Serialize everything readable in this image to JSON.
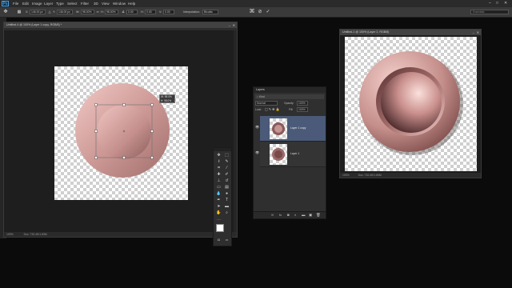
{
  "app": {
    "logo": "Ps"
  },
  "menubar": {
    "items": [
      "File",
      "Edit",
      "Image",
      "Layer",
      "Type",
      "Select",
      "Filter",
      "3D",
      "View",
      "Window",
      "Help"
    ],
    "window_controls": [
      "–",
      "□",
      "✕"
    ]
  },
  "options": {
    "x_value": "146.00 px",
    "y_value": "146.00 px",
    "w_value": "98.00%",
    "h_value": "98.00%",
    "angle_value": "0.00",
    "hskew_value": "0.00",
    "vskew_value": "0.00",
    "interpolation_label": "Interpolation:",
    "interpolation_value": "Bicubic",
    "workspace_placeholder": "Essentials"
  },
  "doc1": {
    "tab_title": "Untitled-4 @ 100% (Layer 1 copy, RGB/8) *",
    "zoom": "100%",
    "doc_size": "Doc: 732.4K/1.83M",
    "transform_readout": {
      "w": "W: 98.0%",
      "h": "H: 98.0%"
    }
  },
  "layers_panel": {
    "title": "Layers",
    "kind_label": "Kind",
    "blend_mode": "Normal",
    "opacity_label": "Opacity:",
    "opacity_value": "100%",
    "lock_label": "Lock:",
    "fill_label": "Fill:",
    "fill_value": "100%",
    "layers": [
      {
        "name": "Layer 1 copy",
        "selected": true
      },
      {
        "name": "Layer 1",
        "selected": false
      }
    ],
    "footer_icons": [
      "link-icon",
      "fx-icon",
      "mask-icon",
      "adjustment-icon",
      "group-icon",
      "new-layer-icon",
      "trash-icon"
    ]
  },
  "tools": {
    "icons": [
      "move-icon",
      "marquee-icon",
      "lasso-icon",
      "quick-select-icon",
      "crop-icon",
      "eyedropper-icon",
      "healing-icon",
      "brush-icon",
      "stamp-icon",
      "history-brush-icon",
      "eraser-icon",
      "gradient-icon",
      "blur-icon",
      "dodge-icon",
      "pen-icon",
      "type-icon",
      "path-select-icon",
      "shape-icon",
      "hand-icon",
      "zoom-icon"
    ]
  },
  "doc2": {
    "tab_title": "Untitled-1 @ 100% (Layer 2, RGB/8)",
    "zoom": "100%",
    "doc_size": "Doc: 732.4K/1.83M"
  },
  "colors": {
    "sphere_light": "#f0c4c0",
    "sphere_mid": "#c88e8a",
    "sphere_dark": "#6a3c3c",
    "selected_layer": "#4a5a78"
  }
}
